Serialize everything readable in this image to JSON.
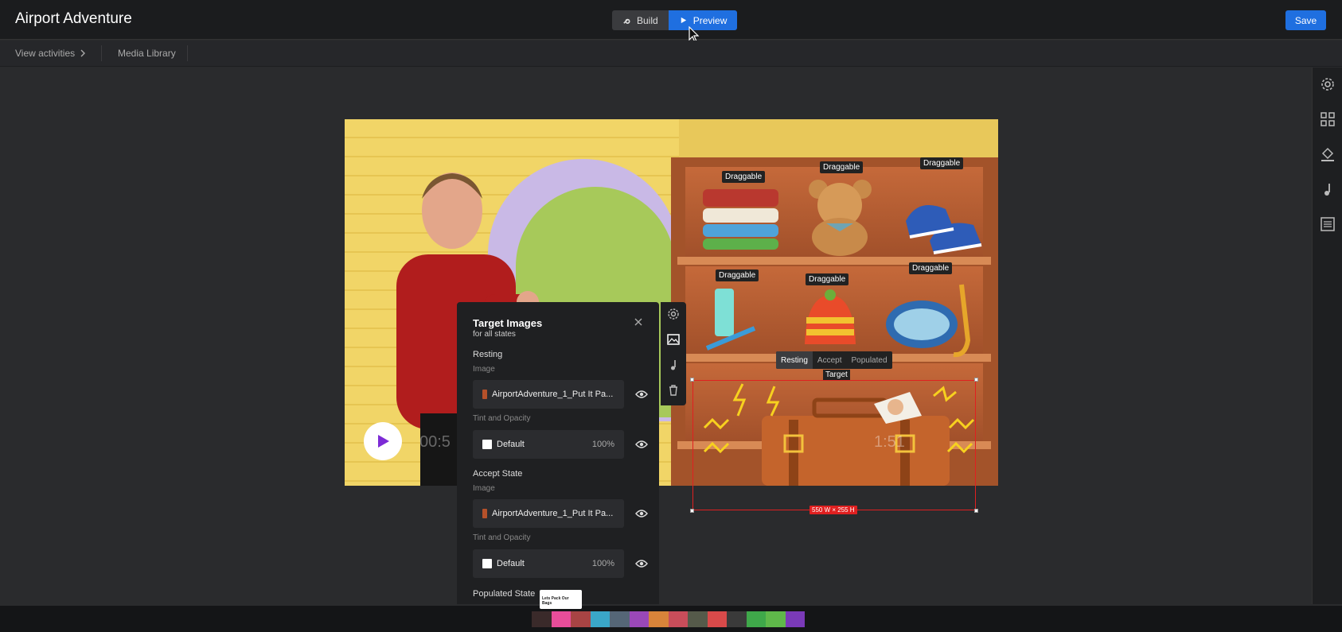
{
  "header": {
    "title": "Airport Adventure",
    "build_label": "Build",
    "preview_label": "Preview",
    "save_label": "Save"
  },
  "subnav": {
    "view_activities": "View activities",
    "media_library": "Media Library"
  },
  "right_rail": [
    "gear-icon",
    "grid-icon",
    "paint-bucket-icon",
    "music-note-icon",
    "list-icon"
  ],
  "canvas": {
    "draggables": [
      "Draggable",
      "Draggable",
      "Draggable",
      "Draggable",
      "Draggable",
      "Draggable"
    ],
    "time_left": "00:5",
    "time_right": "1:51",
    "state_tabs": [
      "Resting",
      "Accept",
      "Populated"
    ],
    "active_state": "Resting",
    "target_label": "Target",
    "dims_label": "550 W × 255 H"
  },
  "panel": {
    "title": "Target Images",
    "subtitle": "for all states",
    "resting_heading": "Resting",
    "image_label": "Image",
    "resting_file": "AirportAdventure_1_Put It Pa...",
    "tint_label": "Tint and Opacity",
    "tint_value": "Default",
    "tint_pct": "100%",
    "accept_heading": "Accept State",
    "accept_image_label": "Image",
    "accept_file": "AirportAdventure_1_Put It Pa...",
    "accept_tint_label": "Tint and Opacity",
    "accept_tint_value": "Default",
    "accept_tint_pct": "100%",
    "populated_heading": "Populated State"
  },
  "tooltip": {
    "line1": "Lets Pack Our Bags"
  },
  "colors": {
    "accent": "#1f6fe0",
    "target_border": "#e02020",
    "topbar": "#1b1c1e"
  }
}
